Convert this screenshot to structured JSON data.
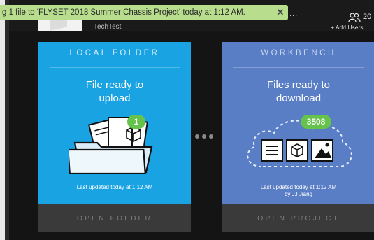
{
  "toast": {
    "message": "g 1 file to 'FLYSET 2018 Summer Chassis Project'  today at 1:12 AM.",
    "close_glyph": "✕",
    "trailing": "..."
  },
  "project": {
    "subtitle": "TechTest"
  },
  "users": {
    "count": "20",
    "add_label": "+ Add Users",
    "icon": "users-icon"
  },
  "local_card": {
    "title": "LOCAL FOLDER",
    "heading_line1": "File ready to",
    "heading_line2": "upload",
    "badge": "1",
    "updated": "Last updated  today at 1:12 AM",
    "footer": "OPEN FOLDER",
    "color": "#1aa3e3"
  },
  "workbench_card": {
    "title": "WORKBENCH",
    "heading_line1": "Files ready to",
    "heading_line2": "download",
    "badge": "3508",
    "updated": "Last updated today at 1:12 AM",
    "updated_by": "by JJ Jiang",
    "footer": "OPEN PROJECT",
    "color": "#5a7ec6"
  },
  "colors": {
    "badge": "#65c24b",
    "toast": "#b7dd8d",
    "footer": "#3a3a3a"
  }
}
